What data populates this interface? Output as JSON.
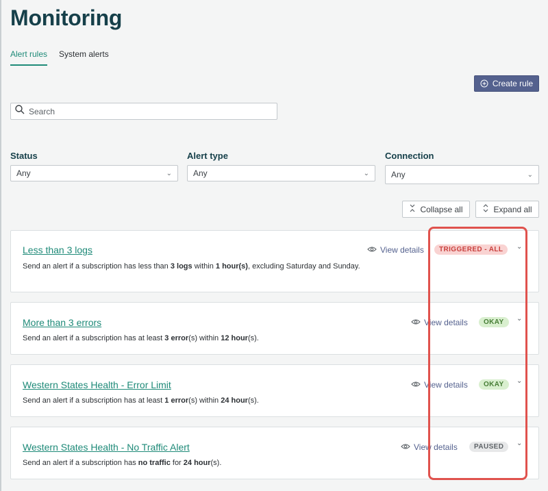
{
  "page": {
    "title": "Monitoring"
  },
  "tabs": [
    {
      "label": "Alert rules",
      "active": true
    },
    {
      "label": "System alerts",
      "active": false
    }
  ],
  "toolbar": {
    "create_label": "Create rule"
  },
  "search": {
    "placeholder": "Search",
    "value": ""
  },
  "filters": {
    "status": {
      "label": "Status",
      "value": "Any"
    },
    "alert_type": {
      "label": "Alert type",
      "value": "Any"
    },
    "connection": {
      "label": "Connection",
      "value": "Any"
    }
  },
  "controls": {
    "collapse_label": "Collapse all",
    "expand_label": "Expand all"
  },
  "rules": [
    {
      "title": "Less than 3 logs",
      "desc": [
        "Send an alert if a subscription has less than ",
        "3 logs",
        " within ",
        "1 hour(s)",
        ", excluding Saturday and Sunday."
      ],
      "view_label": "View details",
      "status": "TRIGGERED - ALL"
    },
    {
      "title": "More than 3 errors",
      "desc": [
        "Send an alert if a subscription has at least ",
        "3 error",
        "(s) within ",
        "12 hour",
        "(s)."
      ],
      "view_label": "View details",
      "status": "OKAY"
    },
    {
      "title": "Western States Health - Error Limit",
      "desc": [
        "Send an alert if a subscription has at least ",
        "1 error",
        "(s) within ",
        "24 hour",
        "(s)."
      ],
      "view_label": "View details",
      "status": "OKAY"
    },
    {
      "title": "Western States Health - No Traffic Alert",
      "desc": [
        "Send an alert if a subscription has ",
        "no traffic",
        " for ",
        "24 hour",
        "(s)."
      ],
      "view_label": "View details",
      "status": "PAUSED"
    }
  ],
  "colors": {
    "accent": "#1e8a78",
    "button": "#54618e",
    "triggered": "#c9403d",
    "okay": "#467d35",
    "paused": "#5f6468",
    "highlight": "#e0524d"
  }
}
